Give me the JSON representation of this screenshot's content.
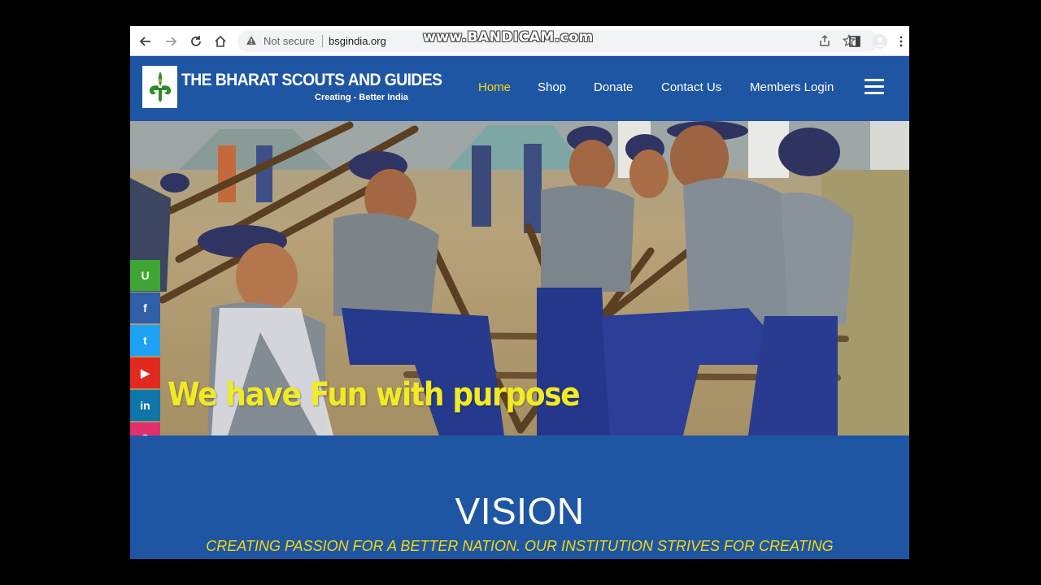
{
  "browser": {
    "security_label": "Not secure",
    "url": "bsgindia.org",
    "watermark": "www.BANDICAM.com"
  },
  "site": {
    "title": "THE BHARAT SCOUTS AND GUIDES",
    "tagline": "Creating - Better India",
    "nav": [
      {
        "label": "Home",
        "active": true
      },
      {
        "label": "Shop",
        "active": false
      },
      {
        "label": "Donate",
        "active": false
      },
      {
        "label": "Contact Us",
        "active": false
      },
      {
        "label": "Members Login",
        "active": false
      }
    ],
    "colors": {
      "header_bg": "#1f56a4",
      "active_nav": "#f5d90a",
      "caption": "#f2ea24"
    }
  },
  "hero": {
    "caption": "We have Fun with purpose",
    "image_icon": "scouts-group-photo"
  },
  "social": [
    {
      "icon": "u-icon",
      "glyph": "U",
      "color": "#3fa535"
    },
    {
      "icon": "facebook-icon",
      "glyph": "f",
      "color": "#2f5fa6"
    },
    {
      "icon": "twitter-icon",
      "glyph": "t",
      "color": "#1da1f2"
    },
    {
      "icon": "youtube-icon",
      "glyph": "▶",
      "color": "#e02a20"
    },
    {
      "icon": "linkedin-icon",
      "glyph": "in",
      "color": "#0e76a8"
    },
    {
      "icon": "instagram-icon",
      "glyph": "◎",
      "color": "#e1306c"
    }
  ],
  "vision": {
    "title": "VISION",
    "text": "CREATING PASSION FOR A BETTER NATION. OUR INSTITUTION STRIVES FOR CREATING"
  }
}
